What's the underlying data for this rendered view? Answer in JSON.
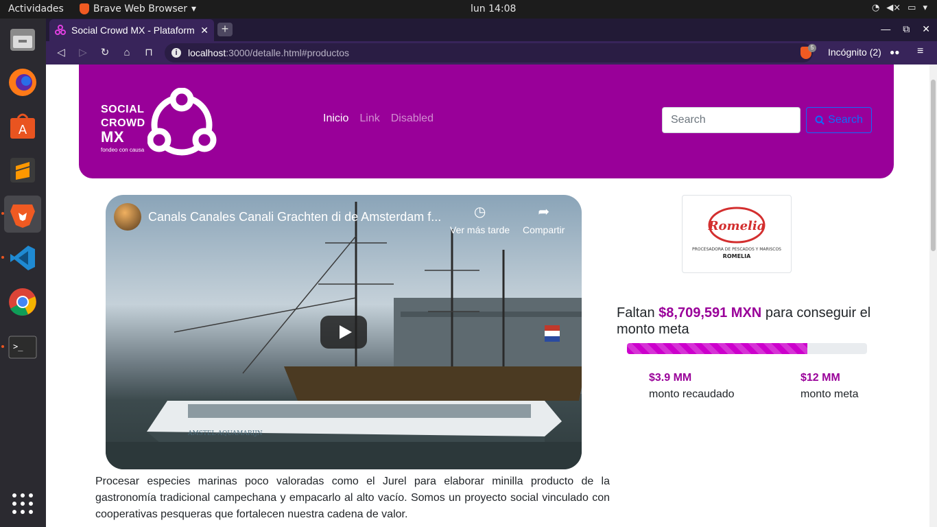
{
  "topbar": {
    "activities": "Actividades",
    "app_name": "Brave Web Browser",
    "clock": "lun 14:08"
  },
  "browser": {
    "tab_title": "Social Crowd MX - Plataform",
    "url_host": "localhost",
    "url_path": ":3000/detalle.html#productos",
    "shield_count": "5",
    "incognito": "Incógnito (2)"
  },
  "site": {
    "logo_line1": "SOCIAL",
    "logo_line2": "CROWD",
    "logo_line3": "MX",
    "logo_tagline": "fondeo con causa",
    "nav": [
      "Inicio",
      "Link",
      "Disabled"
    ],
    "search_placeholder": "Search",
    "search_button": "Search"
  },
  "video": {
    "title": "Canals Canales Canali Grachten di de Amsterdam f...",
    "watch_later": "Ver más tarde",
    "share": "Compartir",
    "boat_name": "AMSTEL-AQUAMARIJN"
  },
  "description": "Procesar especies marinas poco valoradas como el Jurel para elaborar minilla producto de la gastronomía tradicional campechana y empacarlo al alto vacío. Somos un proyecto social vinculado con cooperativas pesqueras que fortalecen nuestra cadena de valor.",
  "company": {
    "logo_name": "Romelia",
    "logo_caption": "PROCESADORA DE PESCADOS Y MARISCOS",
    "logo_subcaption": "ROMELIA"
  },
  "funding": {
    "prefix": "Faltan ",
    "remaining": "$8,709,591 MXN",
    "suffix": " para conseguir el monto meta",
    "progress_fraction": 0.75,
    "raised_value": "$3.9 MM",
    "raised_label": "monto recaudado",
    "goal_value": "$12 MM",
    "goal_label": "monto meta"
  },
  "colors": {
    "brand": "#990099",
    "progress": "#cc00cc",
    "button_outline": "#0d6efd"
  }
}
